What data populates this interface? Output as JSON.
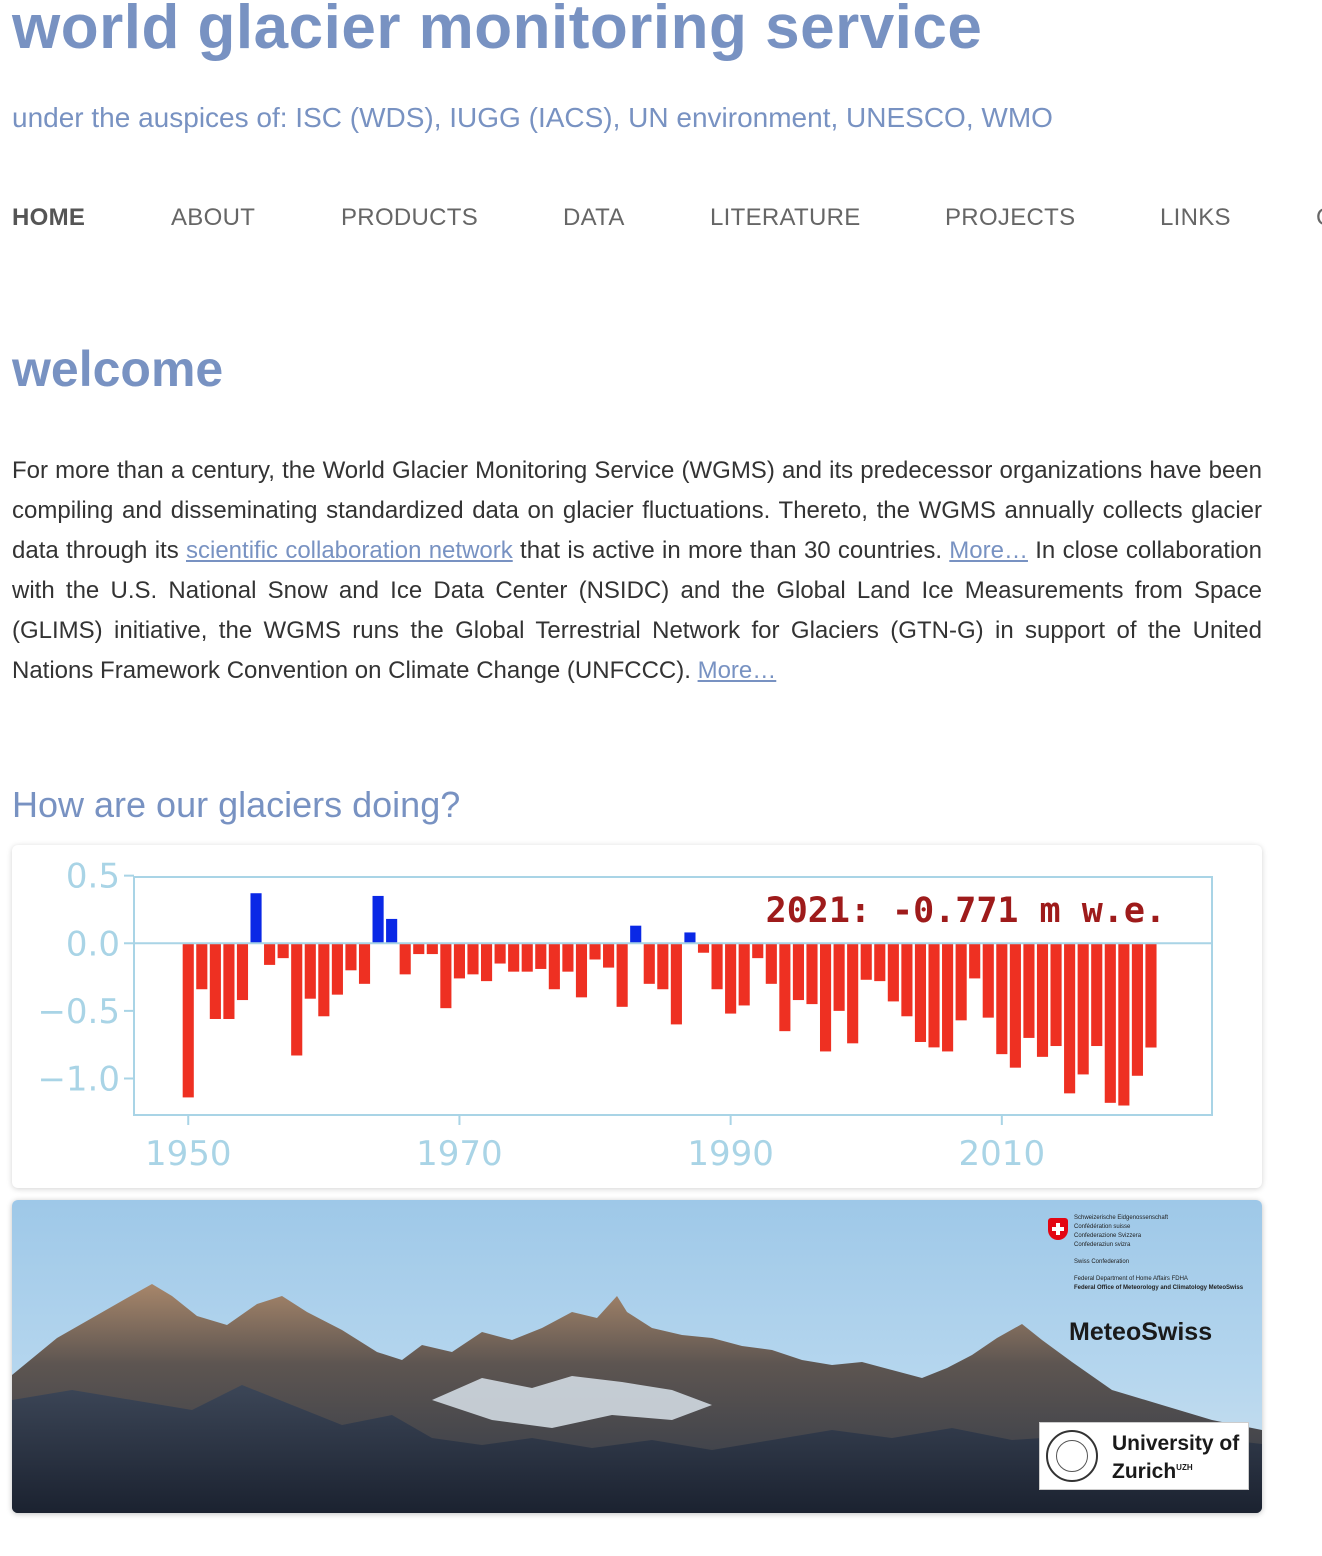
{
  "header": {
    "title": "world glacier monitoring service",
    "subtitle": "under the auspices of: ISC (WDS), IUGG (IACS), UN environment, UNESCO, WMO"
  },
  "nav": {
    "items": [
      {
        "label": "HOME",
        "active": true
      },
      {
        "label": "ABOUT"
      },
      {
        "label": "PRODUCTS"
      },
      {
        "label": "DATA"
      },
      {
        "label": "LITERATURE"
      },
      {
        "label": "PROJECTS"
      },
      {
        "label": "LINKS"
      },
      {
        "label": "C"
      }
    ]
  },
  "welcome": {
    "heading": "welcome",
    "text_1": "For more than a century, the World Glacier Monitoring Service (WGMS) and its predecessor organizations have been compiling and disseminating standardized data on glacier fluctuations. Thereto, the WGMS annually collects glacier data through its ",
    "link_network": "scientific collaboration network",
    "text_2": " that is active in more than 30 countries. ",
    "more_1": "More…",
    "text_3": " In close collaboration with the U.S. National Snow and Ice Data Center (NSIDC) and the Global Land Ice Measurements from Space (GLIMS) initiative, the WGMS runs the Global Terrestrial Network for Glaciers (GTN-G) in support of the United Nations Framework Convention on Climate Change (UNFCCC). ",
    "more_2": "More…"
  },
  "chart_section": {
    "heading": "How are our glaciers doing?"
  },
  "chart_data": {
    "type": "bar",
    "title": "",
    "annotation": "2021: -0.771 m w.e.",
    "xlabel": "",
    "ylabel": "",
    "xlim": [
      1946,
      2025.5
    ],
    "ylim": [
      -1.27,
      0.49
    ],
    "xticks": [
      1950,
      1970,
      1990,
      2010
    ],
    "yticks": [
      0.5,
      0.0,
      -0.5,
      -1.0
    ],
    "ytick_labels": [
      "0.5",
      "0.0",
      "−0.5",
      "−1.0"
    ],
    "grid": false,
    "positive_color": "#0a28e6",
    "negative_color": "#ee3022",
    "axis_color": "#a9d4e6",
    "annotation_color": "#9e1b1b",
    "x": [
      1950,
      1951,
      1952,
      1953,
      1954,
      1955,
      1956,
      1957,
      1958,
      1959,
      1960,
      1961,
      1962,
      1963,
      1964,
      1965,
      1966,
      1967,
      1968,
      1969,
      1970,
      1971,
      1972,
      1973,
      1974,
      1975,
      1976,
      1977,
      1978,
      1979,
      1980,
      1981,
      1982,
      1983,
      1984,
      1985,
      1986,
      1987,
      1988,
      1989,
      1990,
      1991,
      1992,
      1993,
      1994,
      1995,
      1996,
      1997,
      1998,
      1999,
      2000,
      2001,
      2002,
      2003,
      2004,
      2005,
      2006,
      2007,
      2008,
      2009,
      2010,
      2011,
      2012,
      2013,
      2014,
      2015,
      2016,
      2017,
      2018,
      2019,
      2020,
      2021
    ],
    "values": [
      -1.14,
      -0.34,
      -0.56,
      -0.56,
      -0.42,
      0.37,
      -0.16,
      -0.11,
      -0.83,
      -0.41,
      -0.54,
      -0.38,
      -0.2,
      -0.3,
      0.35,
      0.18,
      -0.23,
      -0.08,
      -0.08,
      -0.48,
      -0.26,
      -0.23,
      -0.28,
      -0.15,
      -0.21,
      -0.21,
      -0.19,
      -0.34,
      -0.21,
      -0.4,
      -0.12,
      -0.18,
      -0.47,
      0.13,
      -0.3,
      -0.34,
      -0.6,
      0.08,
      -0.07,
      -0.34,
      -0.52,
      -0.46,
      -0.11,
      -0.3,
      -0.65,
      -0.42,
      -0.45,
      -0.8,
      -0.5,
      -0.74,
      -0.27,
      -0.28,
      -0.43,
      -0.54,
      -0.73,
      -0.77,
      -0.8,
      -0.57,
      -0.26,
      -0.55,
      -0.82,
      -0.92,
      -0.7,
      -0.84,
      -0.76,
      -1.11,
      -0.97,
      -0.76,
      -1.18,
      -1.2,
      -0.98,
      -0.771
    ]
  },
  "banner": {
    "fed_lines_1": [
      "Schweizerische Eidgenossenschaft",
      "Confédération suisse",
      "Confederazione Svizzera",
      "Confederaziun svizra"
    ],
    "fed_line_2": "Swiss Confederation",
    "fed_lines_3": [
      "Federal Department of Home Affairs FDHA",
      "Federal Office of Meteorology and Climatology MeteoSwiss"
    ],
    "meteoswiss": "MeteoSwiss",
    "uzh_line1": "University of",
    "uzh_line2": "Zurich",
    "uzh_sup": "UZH"
  }
}
